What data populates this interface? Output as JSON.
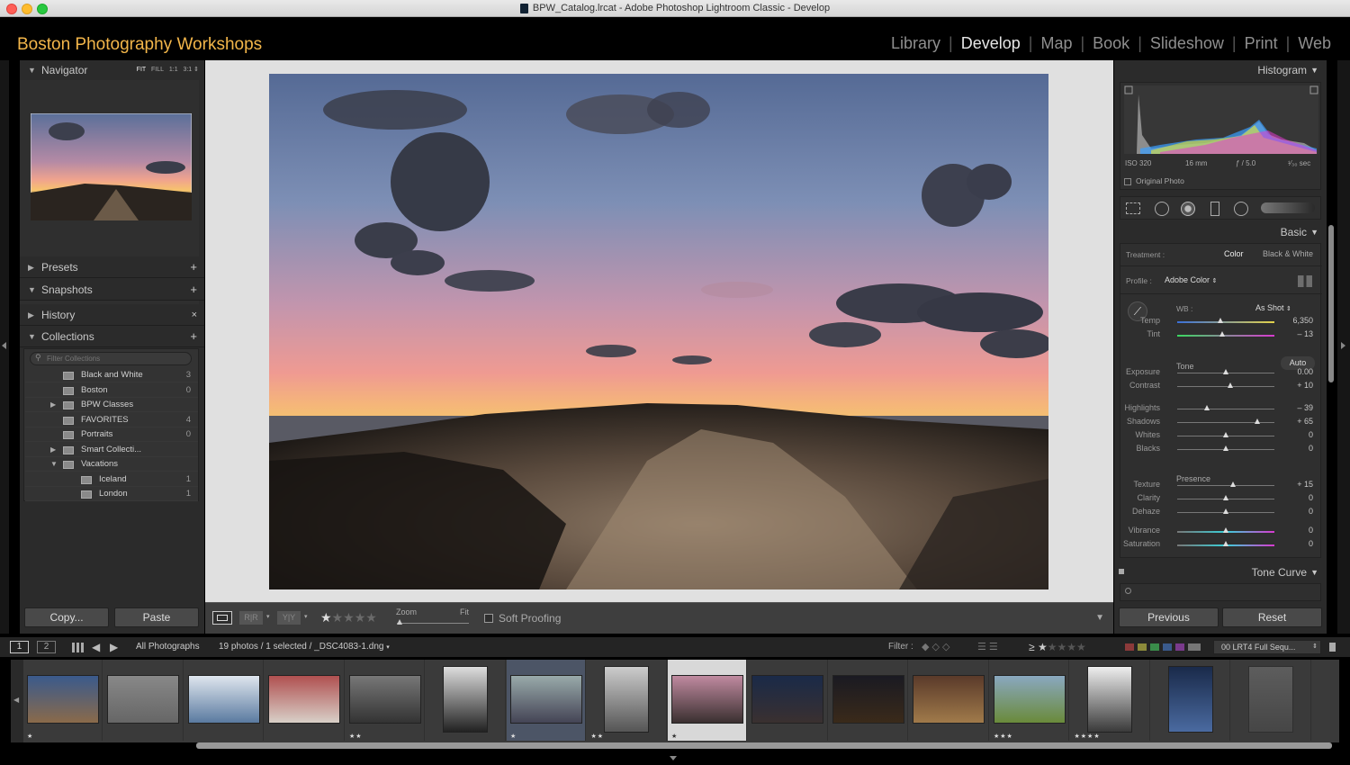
{
  "window": {
    "title": "BPW_Catalog.lrcat - Adobe Photoshop Lightroom Classic - Develop"
  },
  "identity": {
    "brand": "Boston Photography Workshops",
    "modules": [
      "Library",
      "Develop",
      "Map",
      "Book",
      "Slideshow",
      "Print",
      "Web"
    ],
    "active_module": "Develop"
  },
  "left": {
    "navigator": {
      "label": "Navigator",
      "zoom_options": [
        "FIT",
        "FILL",
        "1:1",
        "3:1"
      ]
    },
    "presets": "Presets",
    "snapshots": "Snapshots",
    "history": "History",
    "collections": {
      "label": "Collections",
      "filter_placeholder": "Filter Collections",
      "items": [
        {
          "name": "Black and White",
          "count": "3"
        },
        {
          "name": "Boston",
          "count": "0"
        },
        {
          "name": "BPW Classes",
          "count": ""
        },
        {
          "name": "FAVORITES",
          "count": "4"
        },
        {
          "name": "Portraits",
          "count": "0"
        },
        {
          "name": "Smart Collecti...",
          "count": ""
        },
        {
          "name": "Vacations",
          "count": ""
        },
        {
          "name": "Iceland",
          "count": "1"
        },
        {
          "name": "London",
          "count": "1"
        }
      ]
    },
    "copy_button": "Copy...",
    "paste_button": "Paste"
  },
  "toolbar": {
    "zoom_label": "Zoom",
    "fit_label": "Fit",
    "soft_proofing": "Soft Proofing"
  },
  "right": {
    "histogram": {
      "label": "Histogram",
      "iso": "ISO 320",
      "focal": "16 mm",
      "aperture": "ƒ / 5.0",
      "shutter": "¹⁄₃₀ sec",
      "original_photo": "Original Photo"
    },
    "basic": {
      "label": "Basic",
      "treatment_label": "Treatment :",
      "treatment_color": "Color",
      "treatment_bw": "Black & White",
      "profile_label": "Profile :",
      "profile_value": "Adobe Color",
      "wb_label": "WB :",
      "wb_value": "As Shot",
      "temp": {
        "label": "Temp",
        "value": "6,350",
        "pos": 0.44
      },
      "tint": {
        "label": "Tint",
        "value": "– 13",
        "pos": 0.46
      },
      "tone_label": "Tone",
      "auto": "Auto",
      "exposure": {
        "label": "Exposure",
        "value": "0.00",
        "pos": 0.5
      },
      "contrast": {
        "label": "Contrast",
        "value": "+ 10",
        "pos": 0.55
      },
      "highlights": {
        "label": "Highlights",
        "value": "– 39",
        "pos": 0.31
      },
      "shadows": {
        "label": "Shadows",
        "value": "+ 65",
        "pos": 0.82
      },
      "whites": {
        "label": "Whites",
        "value": "0",
        "pos": 0.5
      },
      "blacks": {
        "label": "Blacks",
        "value": "0",
        "pos": 0.5
      },
      "presence_label": "Presence",
      "texture": {
        "label": "Texture",
        "value": "+ 15",
        "pos": 0.57
      },
      "clarity": {
        "label": "Clarity",
        "value": "0",
        "pos": 0.5
      },
      "dehaze": {
        "label": "Dehaze",
        "value": "0",
        "pos": 0.5
      },
      "vibrance": {
        "label": "Vibrance",
        "value": "0",
        "pos": 0.5
      },
      "saturation": {
        "label": "Saturation",
        "value": "0",
        "pos": 0.5
      }
    },
    "tone_curve": "Tone Curve",
    "previous_button": "Previous",
    "reset_button": "Reset"
  },
  "filmbar": {
    "page1": "1",
    "page2": "2",
    "source": "All Photographs",
    "info": "19 photos / 1 selected / _DSC4083-1.dng",
    "filter_label": "Filter :",
    "preset": "00 LRT4 Full Sequ..."
  },
  "filmstrip": {
    "stars": [
      "★",
      "",
      "",
      "",
      "★★",
      "",
      "★",
      "★★",
      "★",
      "",
      "",
      "",
      "★★★",
      "★★★★",
      "",
      ""
    ]
  },
  "colors": {
    "brand": "#f3b64a",
    "panel": "#2b2b2b",
    "accent_active": "#e6e6e6"
  }
}
